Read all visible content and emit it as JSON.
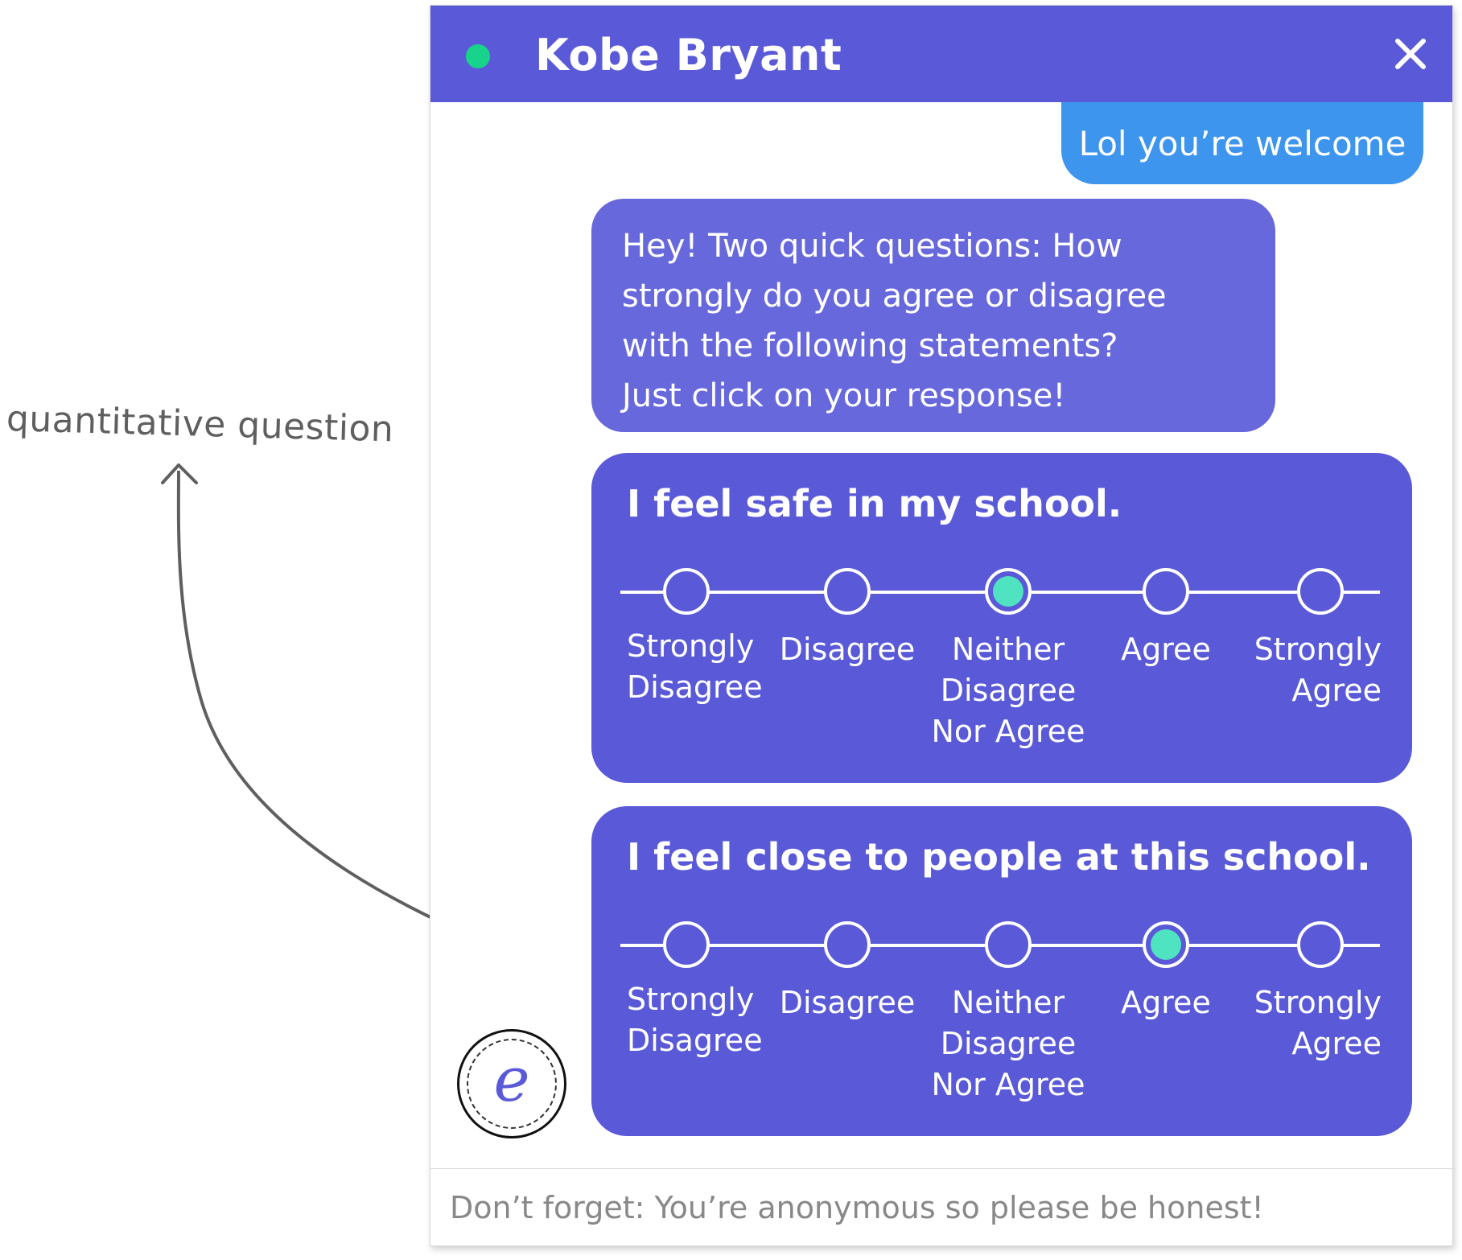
{
  "annotation": {
    "text": "quantitative question"
  },
  "header": {
    "contact_name": "Kobe Bryant",
    "status": "online",
    "close_icon": "close-icon"
  },
  "messages": {
    "user_reply": "Lol you’re welcome",
    "bot_intro_lines": [
      "Hey! Two quick questions: How",
      "strongly do you agree or disagree",
      "with the following statements?",
      "Just click on your response!"
    ]
  },
  "questions": [
    {
      "statement": "I feel safe in my school.",
      "options": [
        "Strongly\nDisagree",
        "Disagree",
        "Neither\nDisagree\nNor Agree",
        "Agree",
        "Strongly\nAgree"
      ],
      "selected_index": 2
    },
    {
      "statement": "I feel close to people at this school.",
      "options": [
        "Strongly\nDisagree",
        "Disagree",
        "Neither\nDisagree\nNor Agree",
        "Agree",
        "Strongly\nAgree"
      ],
      "selected_index": 3
    }
  ],
  "logo": {
    "letter": "e"
  },
  "footer": {
    "text": "Don’t forget: You’re anonymous so please be honest!"
  },
  "colors": {
    "header": "#5a5ad8",
    "status_online": "#17d38b",
    "user_bubble": "#3d95ed",
    "bot_bubble": "#6868dd",
    "question_card": "#5a5ad8",
    "selected_radio": "#4fe3c1"
  }
}
